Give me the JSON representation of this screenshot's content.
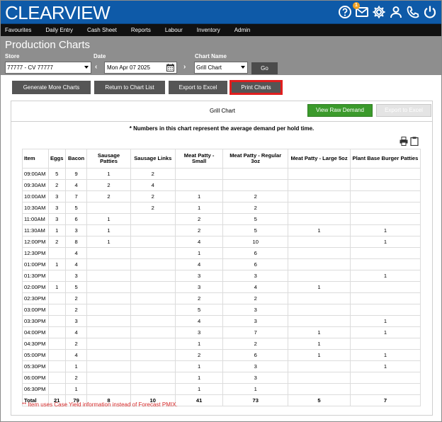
{
  "app": {
    "logo": "CLEARVIEW",
    "badge_count": "1"
  },
  "nav": {
    "items": [
      "Favourites",
      "Daily Entry",
      "Cash Sheet",
      "Reports",
      "Labour",
      "Inventory",
      "Admin"
    ]
  },
  "page": {
    "title": "Production Charts"
  },
  "filters": {
    "store_label": "Store",
    "store_value": "77777 - CV 77777",
    "date_label": "Date",
    "date_value": "Mon Apr 07 2025",
    "chart_label": "Chart Name",
    "chart_value": "Grill Chart",
    "go_label": "Go",
    "prev_arrow": "‹",
    "next_arrow": "›"
  },
  "actions": {
    "generate": "Generate More Charts",
    "return": "Return to Chart List",
    "export": "Export to Excel",
    "print": "Print Charts"
  },
  "panel": {
    "title": "Grill Chart",
    "view_raw": "View Raw Demand",
    "export_disabled": "Export to Excel",
    "note": "* Numbers in this chart represent the average demand per hold time.",
    "footnote": "** Item uses Case Yield information instead of Forecast PMIX."
  },
  "table": {
    "headers": [
      "Item",
      "Eggs",
      "Bacon",
      "Sausage Patties",
      "Sausage Links",
      "Meat Patty - Small",
      "Meat Patty - Regular 3oz",
      "Meat Patty - Large 5oz",
      "Plant Base Burger Patties"
    ],
    "rows": [
      [
        "09:00AM",
        "5",
        "9",
        "1",
        "2",
        "",
        "",
        "",
        ""
      ],
      [
        "09:30AM",
        "2",
        "4",
        "2",
        "4",
        "",
        "",
        "",
        ""
      ],
      [
        "10:00AM",
        "3",
        "7",
        "2",
        "2",
        "1",
        "2",
        "",
        ""
      ],
      [
        "10:30AM",
        "3",
        "5",
        "",
        "2",
        "1",
        "2",
        "",
        ""
      ],
      [
        "11:00AM",
        "3",
        "6",
        "1",
        "",
        "2",
        "5",
        "",
        ""
      ],
      [
        "11:30AM",
        "1",
        "3",
        "1",
        "",
        "2",
        "5",
        "1",
        "1"
      ],
      [
        "12:00PM",
        "2",
        "8",
        "1",
        "",
        "4",
        "10",
        "",
        "1"
      ],
      [
        "12:30PM",
        "",
        "4",
        "",
        "",
        "1",
        "6",
        "",
        ""
      ],
      [
        "01:00PM",
        "1",
        "4",
        "",
        "",
        "4",
        "6",
        "",
        ""
      ],
      [
        "01:30PM",
        "",
        "3",
        "",
        "",
        "3",
        "3",
        "",
        "1"
      ],
      [
        "02:00PM",
        "1",
        "5",
        "",
        "",
        "3",
        "4",
        "1",
        ""
      ],
      [
        "02:30PM",
        "",
        "2",
        "",
        "",
        "2",
        "2",
        "",
        ""
      ],
      [
        "03:00PM",
        "",
        "2",
        "",
        "",
        "5",
        "3",
        "",
        ""
      ],
      [
        "03:30PM",
        "",
        "3",
        "",
        "",
        "4",
        "3",
        "",
        "1"
      ],
      [
        "04:00PM",
        "",
        "4",
        "",
        "",
        "3",
        "7",
        "1",
        "1"
      ],
      [
        "04:30PM",
        "",
        "2",
        "",
        "",
        "1",
        "2",
        "1",
        ""
      ],
      [
        "05:00PM",
        "",
        "4",
        "",
        "",
        "2",
        "6",
        "1",
        "1"
      ],
      [
        "05:30PM",
        "",
        "1",
        "",
        "",
        "1",
        "3",
        "",
        "1"
      ],
      [
        "06:00PM",
        "",
        "2",
        "",
        "",
        "1",
        "3",
        "",
        ""
      ],
      [
        "06:30PM",
        "",
        "1",
        "",
        "",
        "1",
        "1",
        "",
        ""
      ]
    ],
    "total": [
      "Total",
      "21",
      "79",
      "8",
      "10",
      "41",
      "73",
      "5",
      "7"
    ]
  },
  "colors": {
    "topbar": "#0e5aa8",
    "navbar": "#111111",
    "filter_bg": "#8e8e8e",
    "green": "#3b9a2b",
    "red_outline": "#e01e1e"
  },
  "icons": [
    "help-icon",
    "mail-icon",
    "settings-icon",
    "user-icon",
    "phone-icon",
    "power-icon",
    "calendar-icon",
    "print-icon",
    "clipboard-icon"
  ]
}
